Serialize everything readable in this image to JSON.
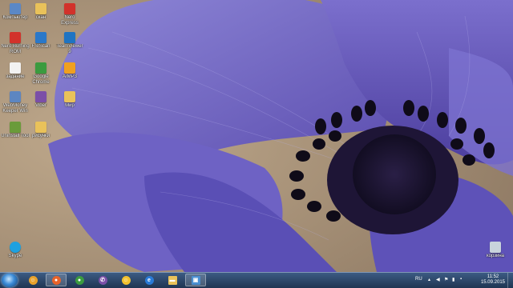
{
  "desktop": {
    "icons": [
      {
        "label": "Компьютер",
        "icon": "computer-icon",
        "color": "#5b88c6"
      },
      {
        "label": "скан",
        "icon": "folder-icon",
        "color": "#e9c25a"
      },
      {
        "label": "Nero Express",
        "icon": "nero-icon",
        "color": "#d2322b"
      },
      {
        "label": "Nero Burning ROM",
        "icon": "nero-burning-icon",
        "color": "#d2322b"
      },
      {
        "label": "FSIScan",
        "icon": "scanner-icon",
        "color": "#2a78c9"
      },
      {
        "label": "TeamViewer 9",
        "icon": "teamviewer-icon",
        "color": "#1f74c2"
      },
      {
        "label": "задание",
        "icon": "document-icon",
        "color": "#f2f2f2"
      },
      {
        "label": "Google Chrome",
        "icon": "chrome-icon",
        "color": "#3b9b3f"
      },
      {
        "label": "AIMP3",
        "icon": "aimp-icon",
        "color": "#f0a020"
      },
      {
        "label": "WebMoney Keeper Win",
        "icon": "webmoney-icon",
        "color": "#5d86c1"
      },
      {
        "label": "Viber",
        "icon": "viber-icon",
        "color": "#7b4fa8"
      },
      {
        "label": "Мир",
        "icon": "folder-icon",
        "color": "#e9c25a"
      },
      {
        "label": "Uninstall Tool",
        "icon": "uninstall-icon",
        "color": "#6a9b3a"
      },
      {
        "label": "рисунки",
        "icon": "folder-icon",
        "color": "#e9c25a"
      },
      {
        "label": "Skype",
        "icon": "skype-icon",
        "color": "#1ea1e0"
      },
      {
        "label": "корзина",
        "icon": "recycle-bin-icon",
        "color": "#c8d3dc"
      }
    ]
  },
  "taskbar": {
    "apps": [
      {
        "icon": "user-icon",
        "glyph": "☺",
        "color": "#e8a22c"
      },
      {
        "icon": "firefox-icon",
        "glyph": "●",
        "color": "#e8632a"
      },
      {
        "icon": "chrome-icon",
        "glyph": "●",
        "color": "#3b9b3f"
      },
      {
        "icon": "viber-icon",
        "glyph": "✆",
        "color": "#7b4fa8"
      },
      {
        "icon": "messenger-icon",
        "glyph": "☺",
        "color": "#f2c12e"
      },
      {
        "icon": "internet-explorer-icon",
        "glyph": "e",
        "color": "#2a7ad6"
      },
      {
        "icon": "explorer-folder-icon",
        "glyph": "▬",
        "color": "#e9c25a"
      },
      {
        "icon": "remote-desktop-icon",
        "glyph": "▣",
        "color": "#4a8fd1"
      }
    ],
    "tray": {
      "language": "RU",
      "time": "11:52",
      "date": "15.09.2015"
    }
  }
}
